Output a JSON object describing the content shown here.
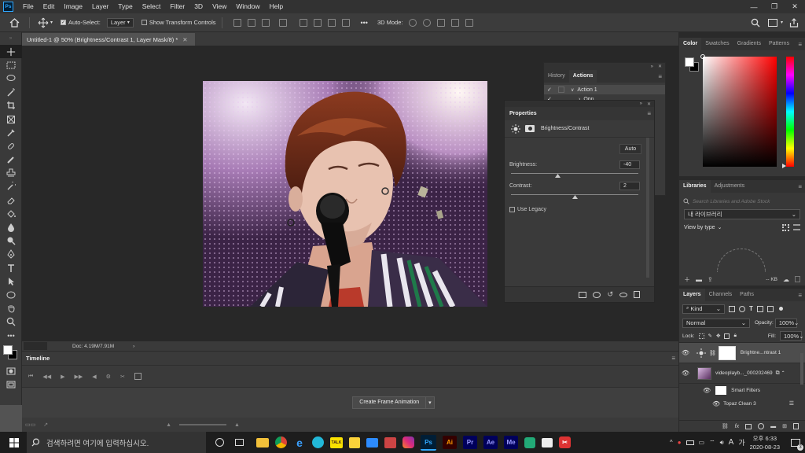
{
  "app": {
    "logo": "Ps"
  },
  "menu": [
    "File",
    "Edit",
    "Image",
    "Layer",
    "Type",
    "Select",
    "Filter",
    "3D",
    "View",
    "Window",
    "Help"
  ],
  "options": {
    "auto_select_label": "Auto-Select:",
    "auto_select_value": "Layer",
    "show_transform": "Show Transform Controls",
    "mode_3d": "3D Mode:",
    "more": "•••"
  },
  "document": {
    "tab_title": "Untitled-1 @ 50% (Brightness/Contrast 1, Layer Mask/8) *",
    "doc_size": "Doc: 4.19M/7.91M"
  },
  "history_panel": {
    "tabs": [
      "History",
      "Actions"
    ],
    "action_name": "Action 1",
    "sub_item": "Opn..."
  },
  "properties": {
    "title": "Properties",
    "adjustment": "Brightness/Contrast",
    "auto_label": "Auto",
    "brightness_label": "Brightness:",
    "brightness_value": "-40",
    "brightness_level": 60,
    "contrast_label": "Contrast:",
    "contrast_value": "2",
    "contrast_level": 51,
    "legacy_label": "Use Legacy"
  },
  "color_panel": {
    "tabs": [
      "Color",
      "Swatches",
      "Gradients",
      "Patterns"
    ],
    "hue": "#ff0000"
  },
  "libraries": {
    "tabs": [
      "Libraries",
      "Adjustments"
    ],
    "search_placeholder": "Search Libraries and Adobe Stock",
    "library_name": "내 라이브러리",
    "view_by": "View by type",
    "kb_label": "-- KB"
  },
  "layers": {
    "tabs": [
      "Layers",
      "Channels",
      "Paths"
    ],
    "kind": "Kind",
    "blend": "Normal",
    "opacity_label": "Opacity:",
    "opacity": "100%",
    "lock_label": "Lock:",
    "fill_label": "Fill:",
    "fill": "100%",
    "items": [
      {
        "name": "Brightne...ntrast 1"
      },
      {
        "name": "videoplayb..._000202469"
      },
      {
        "name": "Smart Filters"
      },
      {
        "name": "Topaz Clean 3"
      }
    ]
  },
  "timeline": {
    "title": "Timeline",
    "create_button": "Create Frame Animation"
  },
  "taskbar": {
    "search_placeholder": "검색하려면 여기에 입력하십시오.",
    "time": "오후 6:33",
    "date": "2020-08-23",
    "notification_count": "3",
    "apps": [
      {
        "label": "Ai",
        "bg": "#330000",
        "fg": "#ff9a00"
      },
      {
        "label": "Pr",
        "bg": "#00005b",
        "fg": "#9999ff"
      },
      {
        "label": "Ae",
        "bg": "#00005b",
        "fg": "#9999ff"
      },
      {
        "label": "Me",
        "bg": "#00005b",
        "fg": "#9999ff"
      }
    ],
    "ime": "A",
    "ime2": "가"
  },
  "colors": {
    "accent": "#31a8ff",
    "panel_bg": "#383838",
    "menubar": "#323232"
  }
}
